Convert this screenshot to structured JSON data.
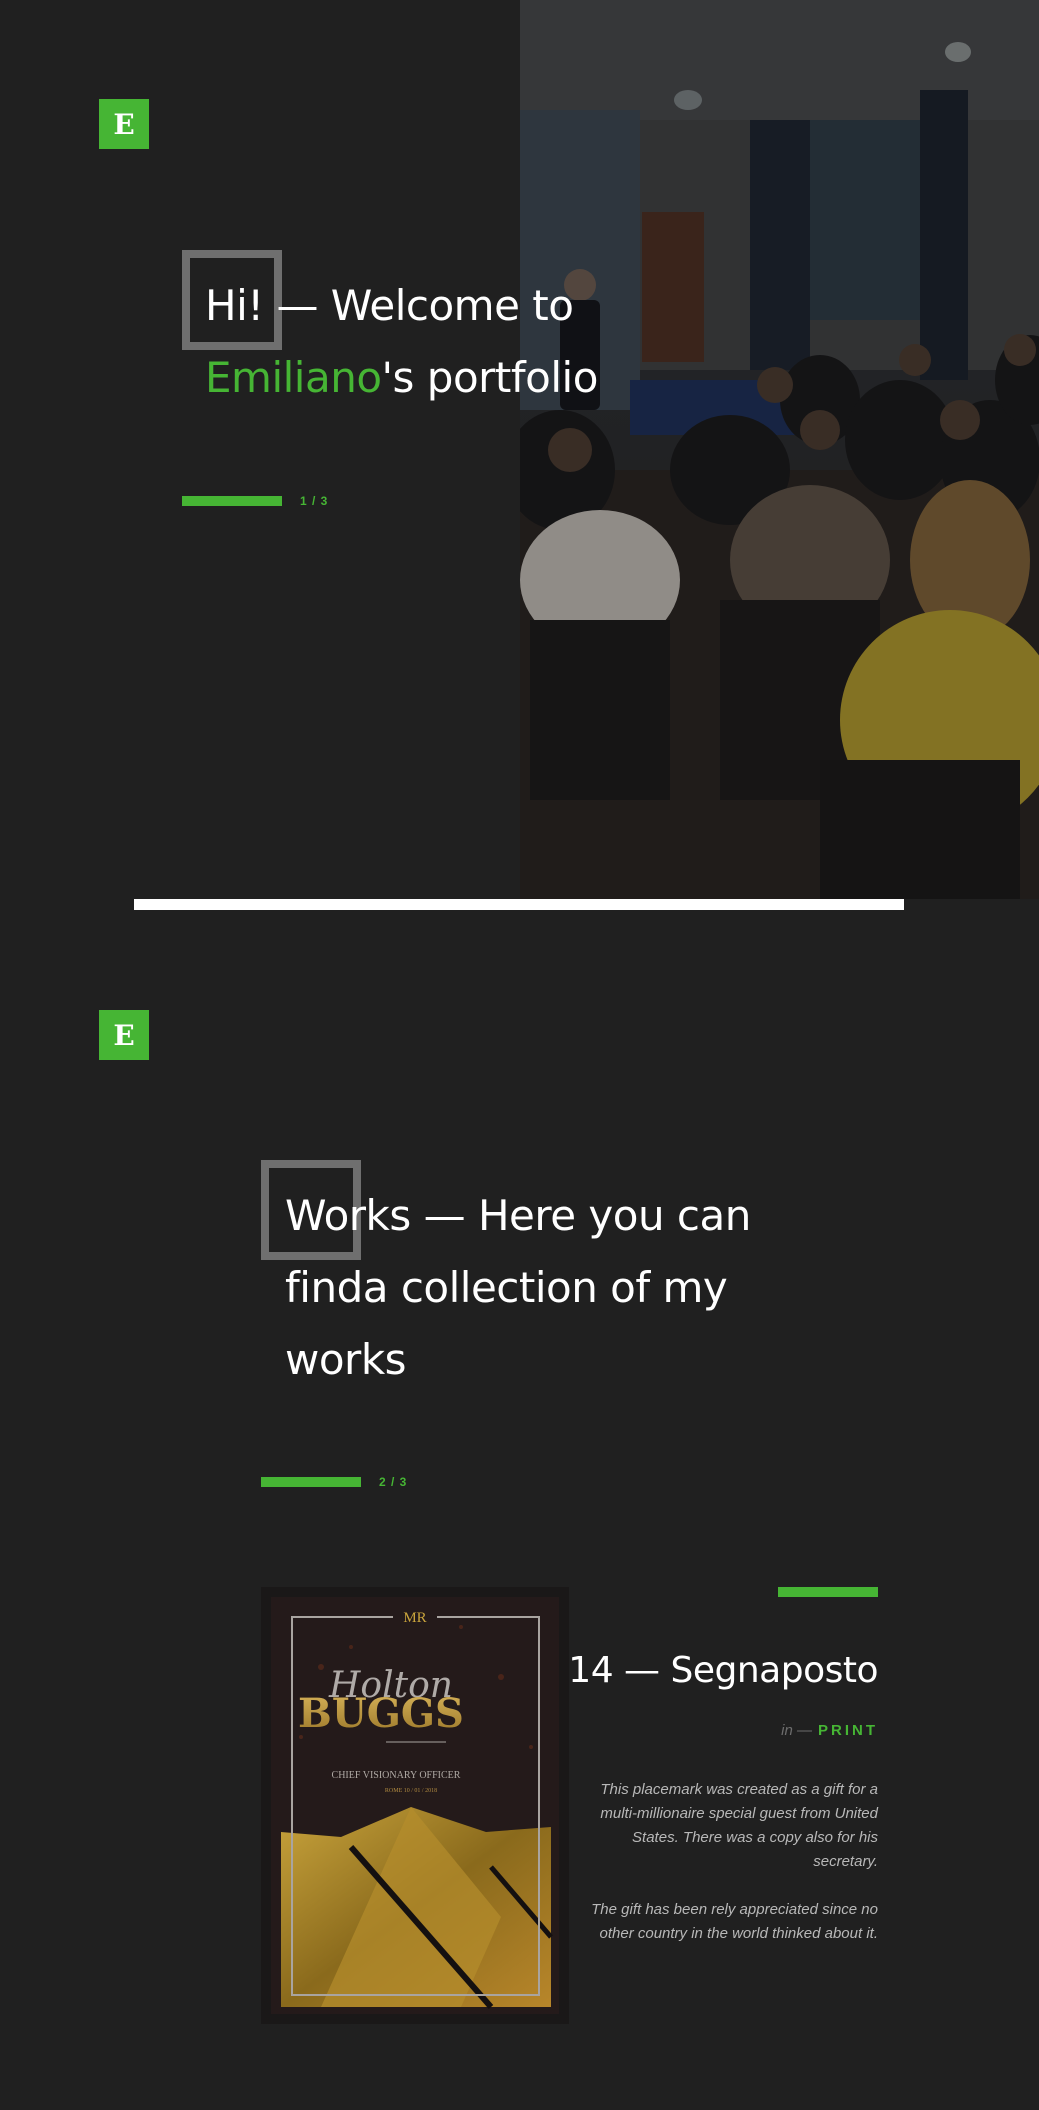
{
  "brand": {
    "logo_letter": "E"
  },
  "hero": {
    "title_part1": "Hi!",
    "title_part2": " — Welcome to",
    "title_name": "Emiliano",
    "title_part3": "'s portfolio",
    "counter": "1 / 3"
  },
  "works": {
    "title_part1": "Works",
    "title_part2": " — Here you can finda collection of my works",
    "counter": "2 / 3"
  },
  "project": {
    "title": "14 — Segnaposto",
    "meta_in": "in —",
    "category": "PRINT",
    "description": [
      "This placemark was created as a gift for a multi-millionaire special guest from United States. There was a copy also for his secretary.",
      "The gift has been rely appreciated since no other country in the world thinked about it."
    ],
    "poster": {
      "top_label": "MR",
      "script_name": "Holton",
      "surname": "BUGGS",
      "role": "CHIEF VISIONARY OFFICER",
      "date": "ROME 10 / 01 / 2018"
    }
  },
  "colors": {
    "accent": "#46b534",
    "background": "#202020",
    "box": "#6f6f6f"
  }
}
